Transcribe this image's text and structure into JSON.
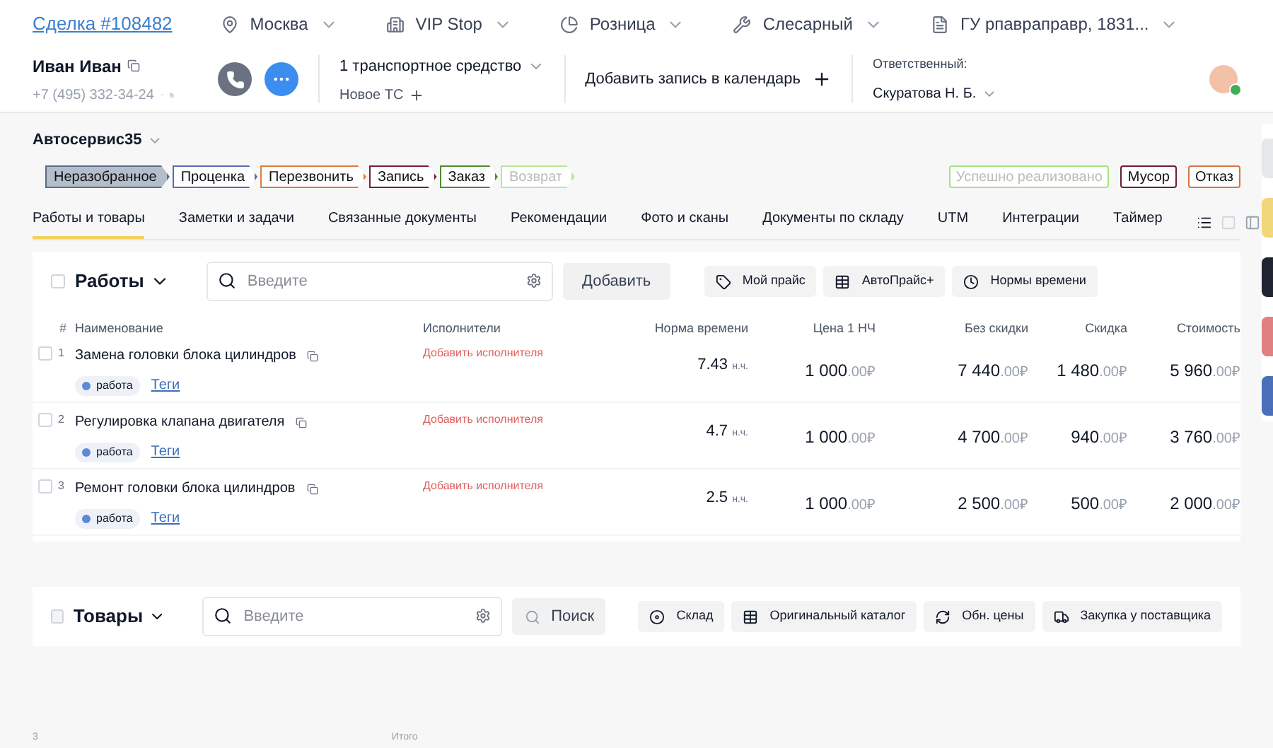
{
  "header": {
    "deal": "Сделка #108482",
    "filters": [
      {
        "kind": "pin",
        "label": "Москва"
      },
      {
        "kind": "building",
        "label": "VIP Stop"
      },
      {
        "kind": "pie",
        "label": "Розница"
      },
      {
        "kind": "wrench",
        "label": "Слесарный"
      },
      {
        "kind": "doc",
        "label": "ГУ рпавраправр, 1831..."
      }
    ],
    "client": {
      "name": "Иван Иван",
      "phone": "+7 (495) 332-34-24"
    },
    "vehicle": {
      "title": "1 транспортное средство",
      "sub": "Новое ТС"
    },
    "calendar": "Добавить запись в календарь",
    "responsible": {
      "label": "Ответственный:",
      "name": "Скуратова Н. Б."
    }
  },
  "company": "Автосервис35",
  "stages": [
    {
      "label": "Неразобранное",
      "selected": true,
      "color": "#5b6b86"
    },
    {
      "label": "Проценка",
      "selected": false,
      "color": "#5b6bb0"
    },
    {
      "label": "Перезвонить",
      "selected": false,
      "color": "#e07b3a"
    },
    {
      "label": "Запись",
      "selected": false,
      "color": "#7a1f3d"
    },
    {
      "label": "Заказ",
      "selected": false,
      "color": "#4f8a2b"
    },
    {
      "label": "Возврат",
      "selected": false,
      "color": "#b6e89a"
    }
  ],
  "outcomes": [
    {
      "label": "Успешно реализовано",
      "color": "#a6e37f"
    },
    {
      "label": "Мусор",
      "color": "#6b1d3a"
    },
    {
      "label": "Отказ",
      "color": "#d7753c"
    }
  ],
  "tabs": [
    {
      "label": "Работы и товары",
      "selected": true
    },
    {
      "label": "Заметки и задачи",
      "selected": false
    },
    {
      "label": "Связанные документы",
      "selected": false
    },
    {
      "label": "Рекомендации",
      "selected": false
    },
    {
      "label": "Фото и сканы",
      "selected": false
    },
    {
      "label": "Документы по складу",
      "selected": false
    },
    {
      "label": "UTM",
      "selected": false
    },
    {
      "label": "Интеграции",
      "selected": false
    },
    {
      "label": "Таймер",
      "selected": false
    }
  ],
  "works": {
    "checked": false,
    "title": "Работы",
    "placeholder": "Введите",
    "add": "Добавить",
    "tools": [
      {
        "kind": "tag",
        "label": "Мой прайс"
      },
      {
        "kind": "table",
        "label": "АвтоПрайс+"
      },
      {
        "kind": "clock",
        "label": "Нормы времени"
      }
    ],
    "columns": [
      "#",
      "Наименование",
      "Исполнители",
      "Норма времени",
      "Цена 1 НЧ",
      "Без скидки",
      "Скидка",
      "Стоимость"
    ],
    "rows": [
      {
        "checked": false,
        "num": "1",
        "name": "Замена головки блока цилиндров",
        "tag": "работа",
        "tags_link": "Теги",
        "executor": "Добавить исполнителя",
        "norm": "7.43",
        "unit": "н.ч.",
        "price": [
          "1 000",
          ".00",
          "₽"
        ],
        "full": [
          "7 440",
          ".00",
          "₽"
        ],
        "discount": [
          "1 480",
          ".00",
          "₽"
        ],
        "cost": [
          "5 960",
          ".00",
          "₽"
        ]
      },
      {
        "checked": false,
        "num": "2",
        "name": "Регулировка клапана двигателя",
        "tag": "работа",
        "tags_link": "Теги",
        "executor": "Добавить исполнителя",
        "norm": "4.7",
        "unit": "н.ч.",
        "price": [
          "1 000",
          ".00",
          "₽"
        ],
        "full": [
          "4 700",
          ".00",
          "₽"
        ],
        "discount": [
          "940",
          ".00",
          "₽"
        ],
        "cost": [
          "3 760",
          ".00",
          "₽"
        ]
      },
      {
        "checked": false,
        "num": "3",
        "name": "Ремонт головки блока цилиндров",
        "tag": "работа",
        "tags_link": "Теги",
        "executor": "Добавить исполнителя",
        "norm": "2.5",
        "unit": "н.ч.",
        "price": [
          "1 000",
          ".00",
          "₽"
        ],
        "full": [
          "2 500",
          ".00",
          "₽"
        ],
        "discount": [
          "500",
          ".00",
          "₽"
        ],
        "cost": [
          "2 000",
          ".00",
          "₽"
        ]
      }
    ]
  },
  "goods": {
    "checked": false,
    "title": "Товары",
    "placeholder": "Введите",
    "search": "Поиск",
    "tools": [
      {
        "kind": "disc",
        "label": "Склад"
      },
      {
        "kind": "table",
        "label": "Оригинальный каталог"
      },
      {
        "kind": "refresh",
        "label": "Обн. цены"
      },
      {
        "kind": "truck",
        "label": "Закупка у поставщика"
      }
    ]
  },
  "footer": {
    "count": "3",
    "total": "Итого"
  }
}
